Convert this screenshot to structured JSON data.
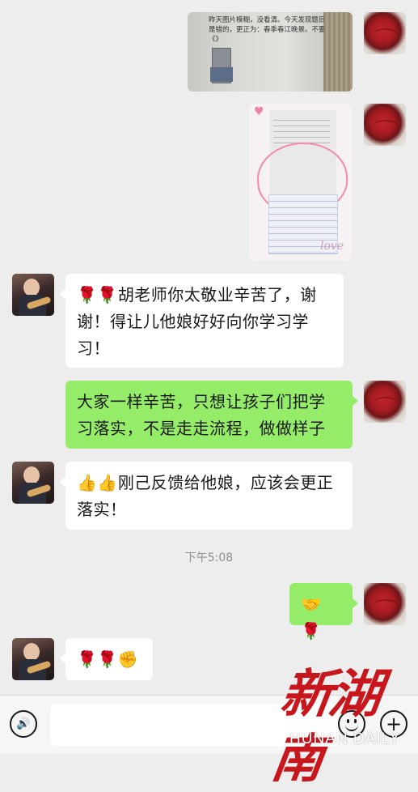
{
  "messages": [
    {
      "id": 1,
      "side": "right",
      "type": "image",
      "image_text": "昨天图片模糊，没看清。今天发现题目是错的，更正为：春季春江晚景。不要《》"
    },
    {
      "id": 2,
      "side": "right",
      "type": "image",
      "image_text": "love"
    },
    {
      "id": 3,
      "side": "left",
      "type": "text",
      "emoji_prefix": "🌹🌹",
      "text": "胡老师你太敬业辛苦了，谢谢！得让儿他娘好好向你学习学习！"
    },
    {
      "id": 4,
      "side": "right",
      "type": "text",
      "text": "大家一样辛苦，只想让孩子们把学习落实，不是走走流程，做做样子"
    },
    {
      "id": 5,
      "side": "left",
      "type": "text",
      "emoji_prefix": "👍👍",
      "text": "刚己反馈给他娘，应该会更正落实！"
    },
    {
      "id": 6,
      "side": "right",
      "type": "emoji",
      "text": "🤝🌹"
    },
    {
      "id": 7,
      "side": "left",
      "type": "emoji",
      "text": "🌹🌹✊"
    }
  ],
  "timestamp": "下午5:08",
  "input_bar": {
    "placeholder": "",
    "voice_icon": "voice-icon",
    "emoji_icon": "emoji-icon",
    "plus_icon": "plus-icon"
  },
  "watermark": {
    "logo_text": "新湖南",
    "subtitle": "HUNAN DAILY"
  },
  "colors": {
    "background": "#ededed",
    "self_bubble": "#95ec69",
    "other_bubble": "#ffffff",
    "timestamp": "#8e8e8e",
    "watermark_red": "#c8161d"
  }
}
